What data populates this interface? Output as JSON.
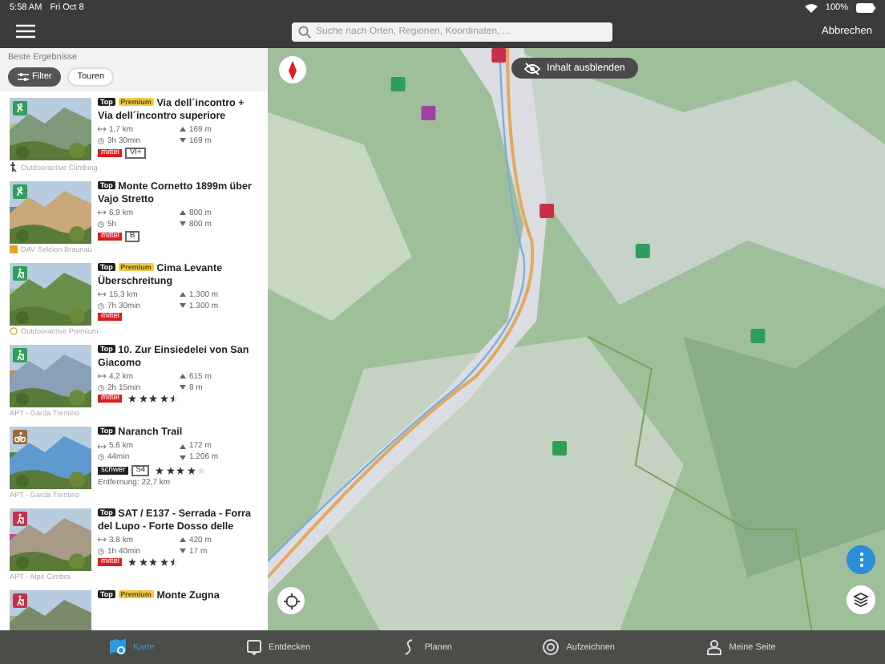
{
  "status_bar": {
    "time": "5:58 AM",
    "date": "Fri Oct 8",
    "battery": "100%"
  },
  "nav": {
    "search": {
      "placeholder": "Suche nach Orten, Regionen, Koordinaten, ..."
    },
    "cancel": "Abbrechen"
  },
  "results": {
    "heading": "Beste Ergebnisse",
    "filters": [
      {
        "label": "Filter",
        "kind": "filter"
      },
      {
        "label": "Touren",
        "kind": "chip"
      }
    ],
    "items": [
      {
        "kind": "climbing",
        "color": "#2e9e5a",
        "badges": [
          "Top",
          "Premium"
        ],
        "title": "Via dell´incontro + Via dell´incontro superiore",
        "distance": "1,7 km",
        "duration": "3h 30min",
        "ascent": "169 m",
        "descent": "169 m",
        "difficulty": {
          "label": "mittel",
          "color": "#d81e1e"
        },
        "grade": "VI+",
        "source": {
          "label": "Outdooractive Climbing",
          "kind": "climbing"
        }
      },
      {
        "kind": "climbing",
        "color": "#2e9e5a",
        "badges": [
          "Top"
        ],
        "title": "Monte Cornetto 1899m über Vajo Stretto",
        "distance": "6,9 km",
        "duration": "5h",
        "ascent": "800 m",
        "descent": "800 m",
        "difficulty": {
          "label": "mittel",
          "color": "#d81e1e"
        },
        "grade": "B",
        "source": {
          "label": "DAV Sektion Braunau",
          "kind": "club"
        }
      },
      {
        "kind": "hiking",
        "color": "#2e9e5a",
        "badges": [
          "Top",
          "Premium"
        ],
        "title": "Cima Levante Überschreitung",
        "distance": "15,3 km",
        "duration": "7h 30min",
        "ascent": "1.300 m",
        "descent": "1.300 m",
        "difficulty": {
          "label": "mittel",
          "color": "#d81e1e"
        },
        "source": {
          "label": "Outdooractive Premium",
          "kind": "premium"
        }
      },
      {
        "kind": "hiking",
        "color": "#2e9e5a",
        "badges": [
          "Top"
        ],
        "title": "10. Zur Einsiedelei von San Giacomo",
        "distance": "4,2 km",
        "duration": "2h 15min",
        "ascent": "615 m",
        "descent": "8 m",
        "difficulty": {
          "label": "mittel",
          "color": "#d81e1e"
        },
        "stars": 4.5,
        "source": {
          "label": "APT - Garda Trentino",
          "kind": "plain"
        }
      },
      {
        "kind": "biking",
        "color": "#9a6a3a",
        "badges": [
          "Top"
        ],
        "title": "Naranch Trail",
        "distance": "5,6 km",
        "duration": "44min",
        "ascent": "172 m",
        "descent": "1.206 m",
        "difficulty": {
          "label": "schwer",
          "color": "#222222"
        },
        "grade": "S4",
        "stars": 4,
        "extra": "Entfernung: 22,7 km",
        "source": {
          "label": "APT - Garda Trentino",
          "kind": "plain"
        }
      },
      {
        "kind": "hiking",
        "color": "#c8304a",
        "badges": [
          "Top"
        ],
        "title": "SAT / E137 - Serrada - Forra del Lupo - Forte Dosso delle",
        "distance": "3,8 km",
        "duration": "1h 40min",
        "ascent": "420 m",
        "descent": "17 m",
        "difficulty": {
          "label": "mittel",
          "color": "#d81e1e"
        },
        "stars": 4.5,
        "source": {
          "label": "APT - Alpe Cimbra",
          "kind": "plain"
        }
      },
      {
        "kind": "hiking",
        "color": "#c8304a",
        "badges": [
          "Top",
          "Premium"
        ],
        "title": "Monte Zugna"
      }
    ]
  },
  "map": {
    "kind": "picture",
    "hide_button": "Inhalt ausblenden"
  },
  "tabs": [
    {
      "label": "Karte",
      "selected": true
    },
    {
      "label": "Entdecken",
      "selected": false
    },
    {
      "label": "Planen",
      "selected": false
    },
    {
      "label": "Aufzeichnen",
      "selected": false
    },
    {
      "label": "Meine Seite",
      "selected": false
    }
  ]
}
